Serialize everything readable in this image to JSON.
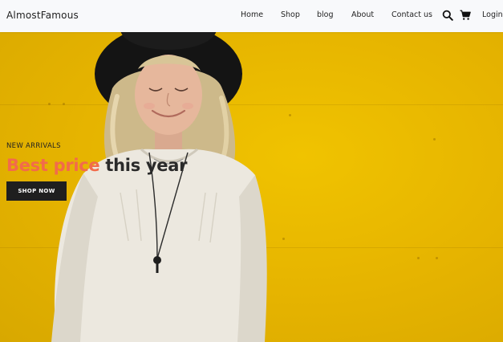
{
  "brand": {
    "name": "AlmostFamous"
  },
  "nav": {
    "items": [
      {
        "label": "Home"
      },
      {
        "label": "Shop"
      },
      {
        "label": "blog"
      },
      {
        "label": "About"
      },
      {
        "label": "Contact us"
      }
    ],
    "search_icon": "search-icon",
    "cart_icon": "cart-icon",
    "login_label": "Login"
  },
  "hero": {
    "eyebrow": "NEW ARRIVALS",
    "headline_accent": "Best price",
    "headline_rest": "this year",
    "cta_label": "SHOP NOW",
    "image": "woman-with-black-hat-smiling-on-yellow-wall"
  },
  "colors": {
    "hero_bg": "#e8b800",
    "accent": "#f26b4b",
    "button_bg": "#1f1f1f",
    "navbar_bg": "#f8f9fb"
  }
}
